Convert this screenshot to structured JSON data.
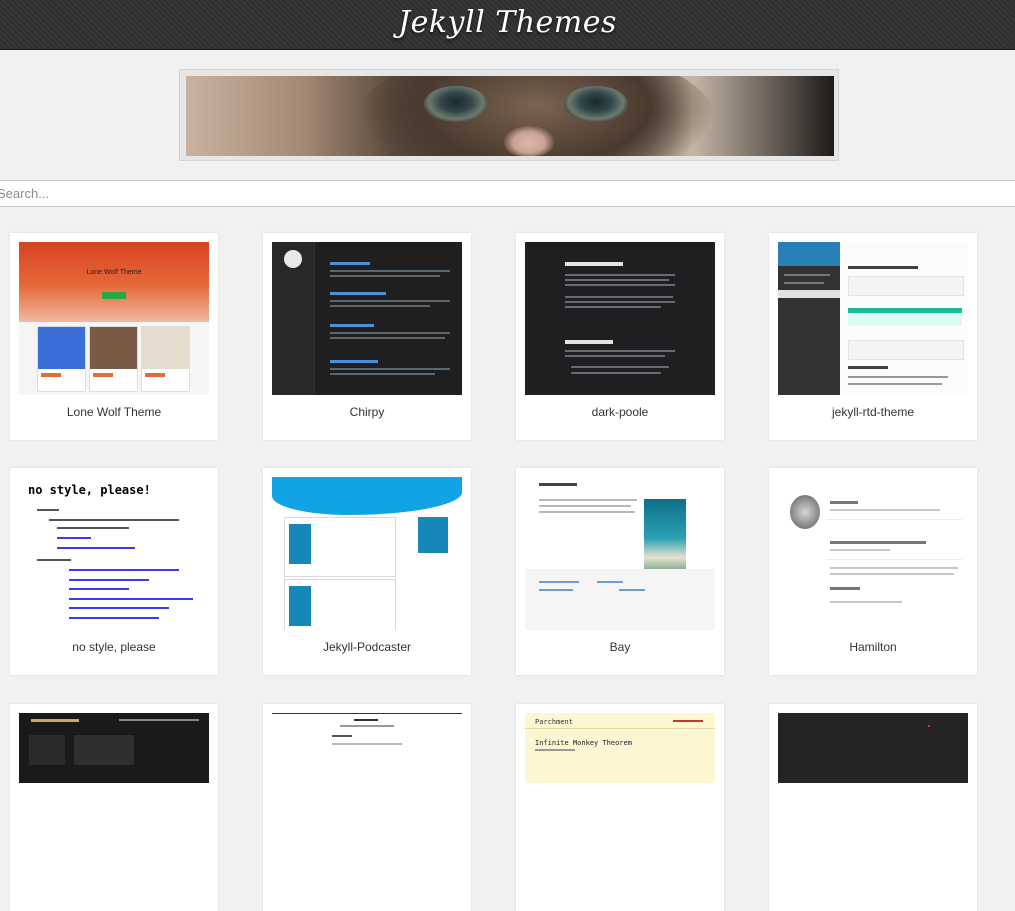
{
  "header": {
    "title": "Jekyll Themes"
  },
  "banner": {
    "alt": "kitten banner"
  },
  "search": {
    "placeholder": "Search..."
  },
  "themes": [
    {
      "name": "Lone Wolf Theme"
    },
    {
      "name": "Chirpy"
    },
    {
      "name": "dark-poole"
    },
    {
      "name": "jekyll-rtd-theme"
    },
    {
      "name": "no style, please"
    },
    {
      "name": "Jekyll-Podcaster"
    },
    {
      "name": "Bay"
    },
    {
      "name": "Hamilton"
    }
  ],
  "previews": {
    "lone_wolf": {
      "hero_title": "Lone Wolf Theme"
    },
    "no_style": {
      "heading": "no style, please!"
    },
    "bay": {
      "title": "BAY THEME"
    },
    "hamilton": {
      "brand": "Hamilton",
      "post1": "Hello World",
      "post2": "This post demonstrates post content styles",
      "post3": "Task Item List"
    },
    "parchment": {
      "brand": "Parchment",
      "post": "Infinite Monkey Theorem"
    }
  },
  "colors": {
    "header_bg": "#2f2f2f",
    "page_bg": "#f1f1f1",
    "card_bg": "#ffffff"
  }
}
